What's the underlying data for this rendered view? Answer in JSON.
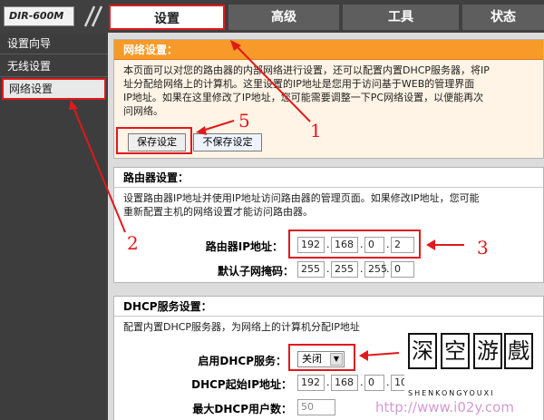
{
  "header": {
    "logo": "DIR-600M",
    "tabs": [
      "设置",
      "高级",
      "工具",
      "状态"
    ]
  },
  "sidebar": {
    "items": [
      "设置向导",
      "无线设置",
      "网络设置"
    ]
  },
  "network": {
    "title": "网络设置：",
    "desc": [
      "本页面可以对您的路由器的内部网络进行设置，还可以配置内置DHCP服务器，将IP",
      "址分配给网络上的计算机。这里设置的IP地址是您用于访问基于WEB的管理界面",
      "IP地址。如果在这里修改了IP地址，您可能需要调整一下PC网络设置，以便能再次",
      "问网络。"
    ],
    "save": "保存设定",
    "nosave": "不保存设定"
  },
  "router": {
    "title": "路由器设置：",
    "desc": [
      "设置路由器IP地址并使用IP地址访问路由器的管理页面。如果修改IP地址，您可能",
      "重新配置主机的网络设置才能访问路由器。"
    ],
    "ip_label": "路由器IP地址：",
    "ip": [
      "192",
      "168",
      "0",
      "2"
    ],
    "mask_label": "默认子网掩码：",
    "mask": [
      "255",
      "255",
      "255",
      "0"
    ]
  },
  "dhcp": {
    "title": "DHCP服务设置：",
    "desc": "配置内置DHCP服务器，为网络上的计算机分配IP地址",
    "enable_label": "启用DHCP服务：",
    "enable_value": "关闭",
    "start_label": "DHCP起始IP地址：",
    "start_ip": [
      "192",
      "168",
      "0",
      "10"
    ],
    "max_label": "最大DHCP用户数：",
    "max_users": "50"
  },
  "annotations": [
    "1",
    "2",
    "3",
    "4",
    "5"
  ],
  "watermark": {
    "chars": [
      "深",
      "空",
      "游",
      "戲"
    ],
    "latin": "SHENKONGYOUXI",
    "url": "http://www.i02y.com"
  },
  "colors": {
    "accent": "#e0191b",
    "orange": "#f79a2a",
    "dark": "#404040"
  }
}
